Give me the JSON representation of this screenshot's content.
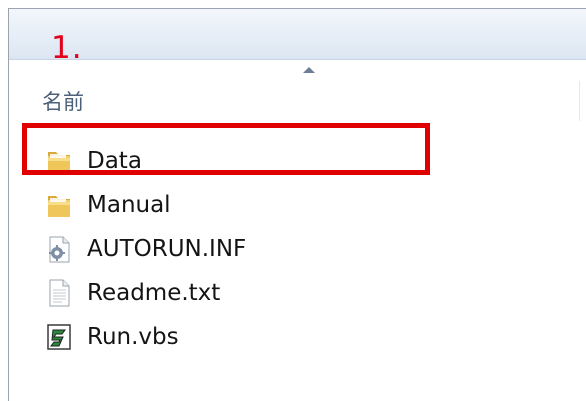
{
  "annotation": {
    "step_label": "1.",
    "color": "#e3001b"
  },
  "header": {
    "column_name": "名前",
    "sort": "ascending"
  },
  "files": [
    {
      "name": "Data",
      "icon": "folder-icon",
      "type": "folder",
      "highlighted": true
    },
    {
      "name": "Manual",
      "icon": "folder-icon",
      "type": "folder",
      "highlighted": false
    },
    {
      "name": "AUTORUN.INF",
      "icon": "settings-file-icon",
      "type": "file",
      "highlighted": false
    },
    {
      "name": "Readme.txt",
      "icon": "text-file-icon",
      "type": "file",
      "highlighted": false
    },
    {
      "name": "Run.vbs",
      "icon": "script-file-icon",
      "type": "file",
      "highlighted": false
    }
  ],
  "colors": {
    "highlight_border": "#e10000",
    "folder": "#e8c15a",
    "header_text": "#4c607a"
  }
}
